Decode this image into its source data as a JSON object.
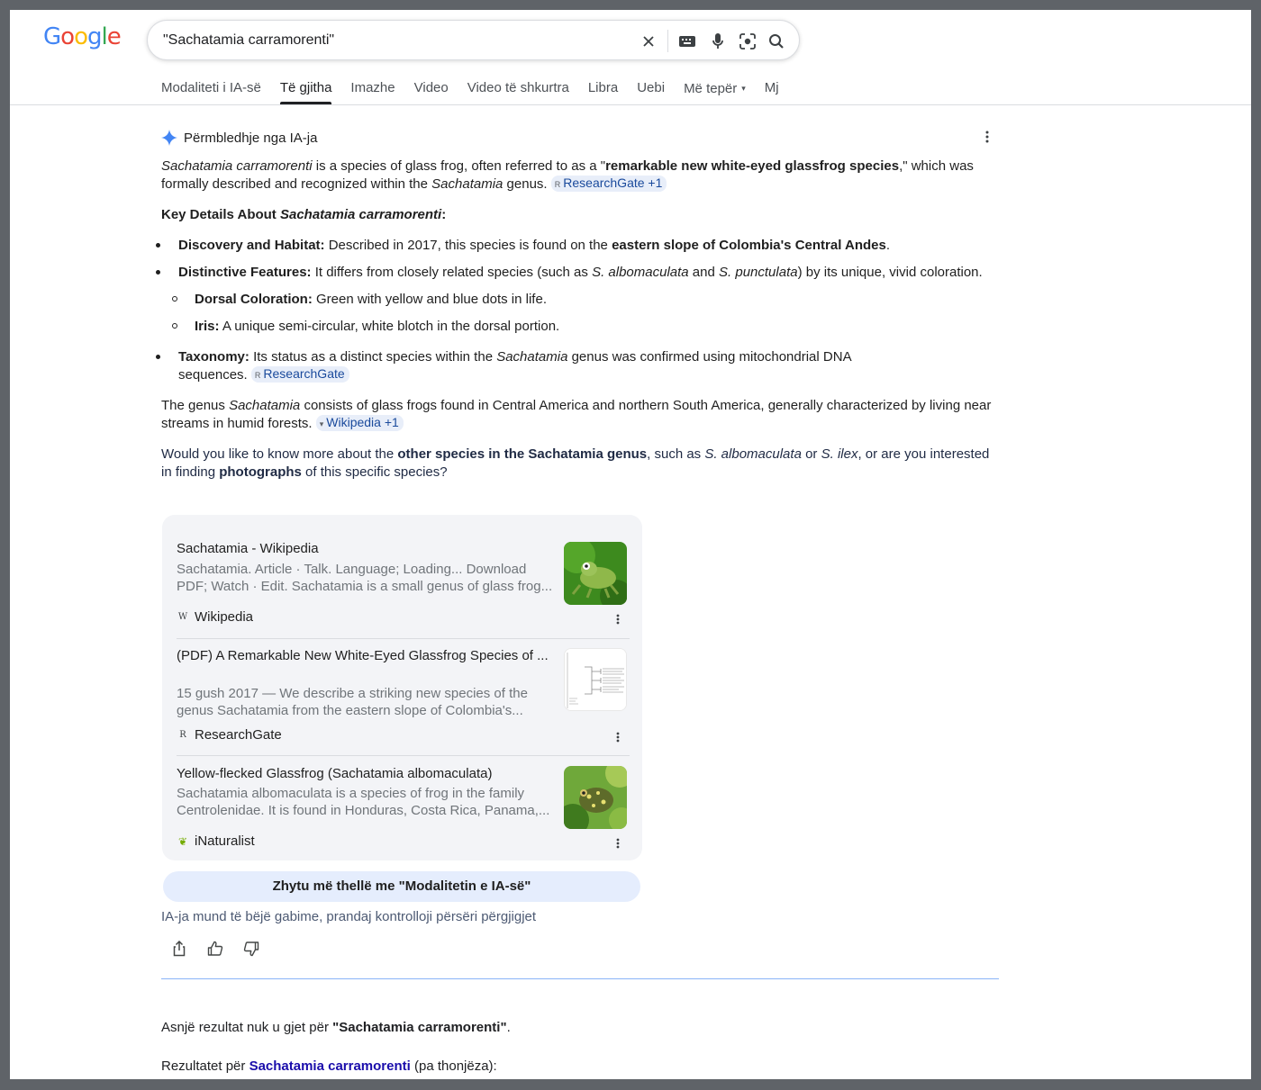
{
  "logo": {
    "letters": [
      "G",
      "o",
      "o",
      "g",
      "l",
      "e"
    ],
    "colors": [
      "#4285f4",
      "#ea4335",
      "#fbbc05",
      "#4285f4",
      "#34a853",
      "#ea4335"
    ]
  },
  "search": {
    "value": "\"Sachatamia carramorenti\""
  },
  "icons": {
    "clear": "close-icon",
    "keyboard": "keyboard-icon",
    "mic": "microphone-icon",
    "lens": "camera-lens-icon",
    "search": "search-icon"
  },
  "tabs": [
    {
      "label": "Modaliteti i IA-së"
    },
    {
      "label": "Të gjitha"
    },
    {
      "label": "Imazhe"
    },
    {
      "label": "Video"
    },
    {
      "label": "Video të shkurtra"
    },
    {
      "label": "Libra"
    },
    {
      "label": "Uebi"
    },
    {
      "label": "Më tepër"
    },
    {
      "label": "Mj"
    }
  ],
  "ai": {
    "heading": "Përmbledhje nga IA-ja",
    "p1": {
      "species": "Sachatamia carramorenti",
      "t1": " is a species of glass frog, often referred to as a \"",
      "b1": "remarkable new white-eyed glassfrog species",
      "t2": ",\" which was formally described and recognized within the ",
      "genus": "Sachatamia",
      "t3": " genus. ",
      "cite": "ResearchGate +1"
    },
    "key_prefix": "Key Details About ",
    "key_species": "Sachatamia carramorenti",
    "key_suffix": ":",
    "b_discovery": {
      "label": "Discovery and Habitat:",
      "t1": " Described in 2017, this species is found on the ",
      "bold": "eastern slope of Colombia's Central Andes",
      "t2": "."
    },
    "b_features": {
      "label": "Distinctive Features:",
      "t1": " It differs from closely related species (such as ",
      "sp1": "S. albomaculata",
      "t2": " and ",
      "sp2": "S. punctulata",
      "t3": ") by its unique, vivid coloration."
    },
    "sub_dorsal": {
      "label": "Dorsal Coloration:",
      "text": " Green with yellow and blue dots in life."
    },
    "sub_iris": {
      "label": "Iris:",
      "text": " A unique semi-circular, white blotch in the dorsal portion."
    },
    "b_taxonomy": {
      "label": "Taxonomy:",
      "t1": " Its status as a distinct species within the ",
      "genus": "Sachatamia",
      "t2": " genus was confirmed using mitochondrial DNA sequences. ",
      "cite": "ResearchGate"
    },
    "p_genus": {
      "t1": "The genus ",
      "genus": "Sachatamia",
      "t2": " consists of glass frogs found in Central America and northern South America, generally characterized by living near streams in humid forests. ",
      "cite": "Wikipedia +1"
    },
    "p_question": {
      "t1": "Would you like to know more about the ",
      "b1": "other species in the Sachatamia genus",
      "t2": ", such as ",
      "sp1": "S. albomaculata",
      "t3": " or ",
      "sp2": "S. ilex",
      "t4": ", or are you interested in finding ",
      "b2": "photographs",
      "t5": " of this specific species?"
    }
  },
  "cards": [
    {
      "title": "Sachatamia - Wikipedia",
      "snippet": "Sachatamia. Article · Talk. Language; Loading... Download PDF; Watch · Edit. Sachatamia is a small genus of glass frog...",
      "source": "Wikipedia",
      "favicon": "W"
    },
    {
      "title": "(PDF) A Remarkable New White-Eyed Glassfrog Species of ...",
      "snippet": "15 gush 2017 — We describe a striking new species of the genus Sachatamia from the eastern slope of Colombia's...",
      "source": "ResearchGate",
      "favicon": "R"
    },
    {
      "title": "Yellow-flecked Glassfrog (Sachatamia albomaculata)",
      "snippet": "Sachatamia albomaculata is a species of frog in the family Centrolenidae. It is found in Honduras, Costa Rica, Panama,...",
      "source": "iNaturalist",
      "favicon": "❦"
    }
  ],
  "deep_dive": "Zhytu më thellë me \"Modalitetin e IA-së\"",
  "disclaimer": "IA-ja mund të bëjë gabime, prandaj kontrolloji përsëri përgjigjet",
  "no_result": {
    "prefix": "Asnjë rezultat nuk u gjet për ",
    "query": "\"Sachatamia carramorenti\"",
    "suffix": "."
  },
  "results_for": {
    "prefix": "Rezultatet për ",
    "link": "Sachatamia carramorenti",
    "suffix": " (pa thonjëza):"
  }
}
